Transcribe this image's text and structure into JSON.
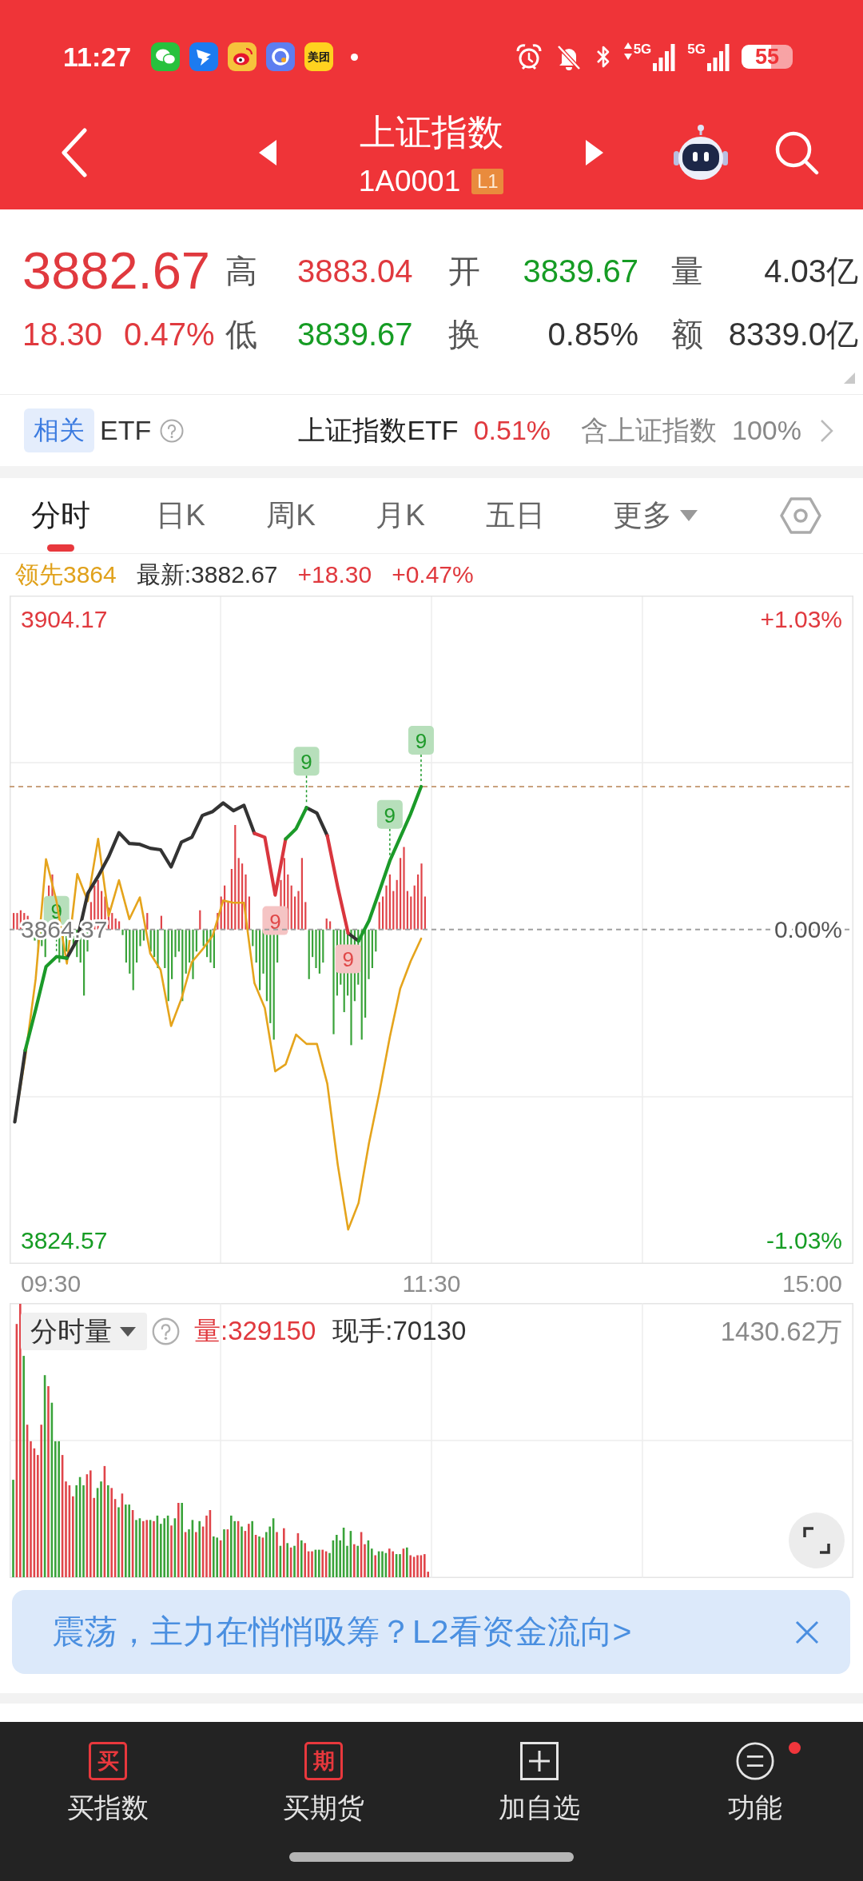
{
  "status_bar": {
    "time": "11:27",
    "app_tile_text": "美团",
    "networks": [
      {
        "label": "5G",
        "kind": "transfer"
      },
      {
        "label": "5G",
        "kind": "plain"
      }
    ],
    "battery": "55"
  },
  "header": {
    "title": "上证指数",
    "code": "1A0001",
    "level_badge": "L1"
  },
  "quote": {
    "price": "3882.67",
    "change": "18.30",
    "change_pct": "0.47%",
    "color": "#e0393e",
    "stats": [
      [
        {
          "label": "高",
          "value": "3883.04",
          "color": "#e0393e"
        },
        {
          "label": "开",
          "value": "3839.67",
          "color": "#169c24"
        },
        {
          "label": "量",
          "value": "4.03亿",
          "color": "#333333"
        }
      ],
      [
        {
          "label": "低",
          "value": "3839.67",
          "color": "#169c24"
        },
        {
          "label": "换",
          "value": "0.85%",
          "color": "#333333"
        },
        {
          "label": "额",
          "value": "8339.0亿",
          "color": "#333333"
        }
      ]
    ]
  },
  "etf": {
    "tag": "相关",
    "label": "ETF",
    "fund": {
      "name": "上证指数ETF",
      "change": "0.51%",
      "color": "#e0393e"
    },
    "holding_label": "含上证指数",
    "holding_weight": "100%"
  },
  "tabs": [
    {
      "label": "分时",
      "selected": true,
      "kind": "tab"
    },
    {
      "label": "日K",
      "selected": false,
      "kind": "tab"
    },
    {
      "label": "周K",
      "selected": false,
      "kind": "tab"
    },
    {
      "label": "月K",
      "selected": false,
      "kind": "tab"
    },
    {
      "label": "五日",
      "selected": false,
      "kind": "tab"
    },
    {
      "label": "更多",
      "selected": false,
      "kind": "dropdown"
    }
  ],
  "legend": [
    {
      "text": "领先3864",
      "color": "#e0a11b"
    },
    {
      "text": "最新:3882.67",
      "color": "#333333"
    },
    {
      "text": "+18.30",
      "color": "#e0393e"
    },
    {
      "text": "+0.47%",
      "color": "#e0393e"
    }
  ],
  "chart": {
    "percent_ticks": [
      "+1.03%",
      "0.00%",
      "-1.03%"
    ],
    "time_labels": [
      "09:30",
      "11:30",
      "15:00"
    ],
    "signal_markers": [
      {
        "color": "#1f9a2b",
        "above": true
      },
      {
        "color": "#e04848",
        "above": false
      },
      {
        "color": "#1f9a2b",
        "above": true
      },
      {
        "color": "#e04848",
        "above": false
      },
      {
        "color": "#1f9a2b",
        "above": true
      },
      {
        "color": "#1f9a2b",
        "above": true
      }
    ],
    "chart_data": {
      "type": "line",
      "ylim": [
        3821.5,
        3907.2
      ],
      "categories": [
        null,
        null,
        null,
        null,
        null,
        null,
        null,
        null,
        null,
        null,
        null,
        null,
        null,
        null,
        null,
        null,
        null,
        null,
        null,
        null,
        null,
        null,
        null,
        null,
        null,
        null,
        null,
        null,
        null,
        null,
        null,
        null,
        null,
        null,
        null,
        null,
        null,
        null,
        null,
        null,
        null,
        null,
        null,
        null,
        null,
        null,
        null,
        null,
        null,
        null,
        null,
        null,
        null,
        null,
        null,
        null,
        null,
        null,
        null,
        null,
        null,
        null,
        null,
        null,
        null,
        null,
        null,
        null,
        null,
        null,
        null,
        null,
        null,
        null,
        null,
        null,
        null,
        null,
        null,
        null,
        null
      ],
      "yticks": [
        {
          "value": 3904.17,
          "label": "3904.17"
        },
        {
          "value": 3864.37,
          "label": "3864.37"
        },
        {
          "value": 3824.57,
          "label": "3824.57"
        }
      ],
      "ref_lines": [
        {
          "axis": "y",
          "value": 3864.37
        },
        {
          "axis": "y",
          "value": 3882.7
        }
      ],
      "series": [
        {
          "color": "#e5a41c",
          "values": [
            3839.7,
            3848.0,
            3858.0,
            3873.4,
            3868.0,
            3860.0,
            3871.5,
            3868.0,
            3876.0,
            3866.1,
            3870.7,
            3865.7,
            3868.5,
            3861.3,
            3859.2,
            3852.0,
            3855.5,
            3860.2,
            3861.8,
            3863.6,
            3868.1,
            3867.8,
            3867.8,
            3857.5,
            3854.3,
            3846.2,
            3847.1,
            3850.9,
            3849.7,
            3849.7,
            3844.6,
            3834.2,
            3825.9,
            3829.3,
            3837.0,
            3843.5,
            3850.6,
            3856.8,
            3860.3,
            3863.2,
            null,
            null,
            null,
            null,
            null,
            null,
            null,
            null,
            null,
            null,
            null,
            null,
            null,
            null,
            null,
            null,
            null,
            null,
            null,
            null,
            null,
            null,
            null,
            null,
            null,
            null,
            null,
            null,
            null,
            null,
            null,
            null,
            null,
            null,
            null,
            null,
            null,
            null,
            null,
            null,
            null
          ]
        },
        {
          "color": "#333333",
          "values": [
            3839.7,
            3848.9,
            null,
            null,
            null,
            3860.7,
            3863.1,
            3869.0,
            3871.2,
            3873.7,
            3876.8,
            3875.4,
            3875.3,
            3874.8,
            3874.6,
            3872.4,
            3875.6,
            3876.2,
            3879.0,
            3879.5,
            3880.6,
            3879.6,
            3880.3,
            3876.7,
            null,
            null,
            null,
            null,
            3880.0,
            3879.3,
            3876.4,
            null,
            3863.9,
            3862.9,
            null,
            null,
            null,
            null,
            null,
            null,
            null,
            null,
            null,
            null,
            null,
            null,
            null,
            null,
            null,
            null,
            null,
            null,
            null,
            null,
            null,
            null,
            null,
            null,
            null,
            null,
            null,
            null,
            null,
            null,
            null,
            null,
            null,
            null,
            null,
            null,
            null,
            null,
            null,
            null,
            null,
            null,
            null,
            null,
            null,
            null,
            null
          ]
        },
        {
          "color": "#d9363e",
          "values": [
            null,
            null,
            null,
            null,
            null,
            null,
            null,
            null,
            null,
            null,
            null,
            null,
            null,
            null,
            null,
            null,
            null,
            null,
            null,
            null,
            null,
            null,
            null,
            3876.7,
            3876.2,
            3868.8,
            3876.0,
            null,
            null,
            null,
            3876.4,
            3869.8,
            3863.9,
            null,
            null,
            null,
            null,
            null,
            null,
            null,
            null,
            null,
            null,
            null,
            null,
            null,
            null,
            null,
            null,
            null,
            null,
            null,
            null,
            null,
            null,
            null,
            null,
            null,
            null,
            null,
            null,
            null,
            null,
            null,
            null,
            null,
            null,
            null,
            null,
            null,
            null,
            null,
            null,
            null,
            null,
            null,
            null,
            null,
            null,
            null,
            null
          ]
        },
        {
          "color": "#1b9a29",
          "values": [
            null,
            3848.9,
            3854.1,
            3859.6,
            3860.9,
            3860.7,
            null,
            null,
            null,
            null,
            null,
            null,
            null,
            null,
            null,
            null,
            null,
            null,
            null,
            null,
            null,
            null,
            null,
            null,
            null,
            null,
            3876.0,
            3877.3,
            3880.0,
            null,
            null,
            null,
            null,
            3862.9,
            3865.5,
            3869.3,
            3873.2,
            3876.2,
            3879.2,
            3882.7,
            null,
            null,
            null,
            null,
            null,
            null,
            null,
            null,
            null,
            null,
            null,
            null,
            null,
            null,
            null,
            null,
            null,
            null,
            null,
            null,
            null,
            null,
            null,
            null,
            null,
            null,
            null,
            null,
            null,
            null,
            null,
            null,
            null,
            null,
            null,
            null,
            null,
            null,
            null,
            null,
            null
          ]
        }
      ],
      "annotations": [
        "9",
        "9",
        "9",
        "9",
        "9",
        "9"
      ]
    }
  },
  "volume": {
    "title": "分时量",
    "volume": "量:329150",
    "current_hands": "现手:70130",
    "max_label": "1430.62万"
  },
  "banner": {
    "text": "震荡，主力在悄悄吸筹？L2看资金流向>"
  },
  "bottom_nav": [
    {
      "kind": "glyph",
      "icon_text": "买",
      "label": "买指数",
      "alert": false
    },
    {
      "kind": "glyph",
      "icon_text": "期",
      "label": "买期货",
      "alert": false
    },
    {
      "kind": "plus",
      "label": "加自选",
      "alert": false
    },
    {
      "kind": "menu",
      "label": "功能",
      "alert": true
    }
  ]
}
